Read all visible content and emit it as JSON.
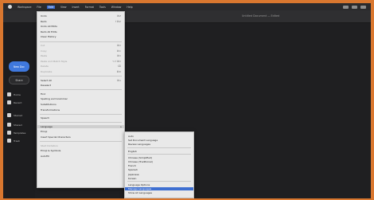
{
  "menubar": {
    "items": [
      {
        "label": "Workspace",
        "active": false
      },
      {
        "label": "File",
        "active": false
      },
      {
        "label": "Edit",
        "active": true
      },
      {
        "label": "View",
        "active": false
      },
      {
        "label": "Insert",
        "active": false
      },
      {
        "label": "Format",
        "active": false
      },
      {
        "label": "Tools",
        "active": false
      },
      {
        "label": "Window",
        "active": false
      },
      {
        "label": "Help",
        "active": false
      }
    ],
    "status_icons": [
      "wifi-icon",
      "battery-icon",
      "clock-icon"
    ]
  },
  "window": {
    "title": "Untitled Document — Edited"
  },
  "sidebar": {
    "new_button": "New Doc",
    "share_button": "Share",
    "items": [
      {
        "label": "Home",
        "icon": "home-icon"
      },
      {
        "label": "Recent",
        "icon": "clock-icon"
      },
      {
        "label": "Starred",
        "icon": "star-icon"
      },
      {
        "label": "Shared",
        "icon": "people-icon"
      },
      {
        "label": "Templates",
        "icon": "template-icon"
      },
      {
        "label": "Trash",
        "icon": "trash-icon"
      }
    ]
  },
  "edit_menu": {
    "rows": [
      {
        "label": "Undo",
        "shortcut": "⌘Z",
        "dim": false
      },
      {
        "label": "Redo",
        "shortcut": "⇧⌘Z",
        "dim": false
      },
      {
        "label": "Undo All Edits",
        "shortcut": "",
        "dim": false
      },
      {
        "label": "Redo All Edits",
        "shortcut": "",
        "dim": false
      },
      {
        "label": "Clear History",
        "shortcut": "",
        "dim": false
      },
      {
        "label": "Cut",
        "shortcut": "⌘X",
        "dim": true
      },
      {
        "label": "Copy",
        "shortcut": "⌘C",
        "dim": true
      },
      {
        "label": "Paste",
        "shortcut": "⌘V",
        "dim": true
      },
      {
        "label": "Paste and Match Style",
        "shortcut": "⌥⇧⌘V",
        "dim": true
      },
      {
        "label": "Delete",
        "shortcut": "⌫",
        "dim": true
      },
      {
        "label": "Duplicate",
        "shortcut": "⌘D",
        "dim": true
      },
      {
        "label": "Select All",
        "shortcut": "⌘A",
        "dim": false
      },
      {
        "label": "Deselect",
        "shortcut": "",
        "dim": false
      },
      {
        "label": "Find",
        "shortcut": "",
        "dim": false
      },
      {
        "label": "Spelling and Grammar",
        "shortcut": "",
        "dim": false
      },
      {
        "label": "Substitutions",
        "shortcut": "",
        "dim": false
      },
      {
        "label": "Transformations",
        "shortcut": "",
        "dim": false
      },
      {
        "label": "Speech",
        "shortcut": "",
        "dim": false
      },
      {
        "label": "Language",
        "shortcut": "",
        "dim": false,
        "highlighted": true,
        "submenu": true
      },
      {
        "label": "Emoji",
        "shortcut": "",
        "dim": false
      },
      {
        "label": "Insert Special Characters",
        "shortcut": "",
        "dim": false
      },
      {
        "label": "Start Dictation",
        "shortcut": "",
        "dim": true
      },
      {
        "label": "Emoji & Symbols",
        "shortcut": "",
        "dim": false
      },
      {
        "label": "AutoFill",
        "shortcut": "",
        "dim": false
      }
    ]
  },
  "language_submenu": {
    "rows": [
      {
        "label": "Auto",
        "highlighted": false
      },
      {
        "label": "Set Document Language",
        "highlighted": false
      },
      {
        "label": "Review Languages",
        "highlighted": false
      },
      {
        "label": "English",
        "highlighted": false
      },
      {
        "label": "Chinese (Simplified)",
        "highlighted": false
      },
      {
        "label": "Chinese (Traditional)",
        "highlighted": false
      },
      {
        "label": "French",
        "highlighted": false
      },
      {
        "label": "Spanish",
        "highlighted": false
      },
      {
        "label": "Japanese",
        "highlighted": false
      },
      {
        "label": "Korean",
        "highlighted": false
      },
      {
        "label": "Language Options",
        "highlighted": false
      },
      {
        "label": "Manage Languages",
        "highlighted": true
      },
      {
        "label": "Show All Languages",
        "highlighted": false
      }
    ]
  }
}
